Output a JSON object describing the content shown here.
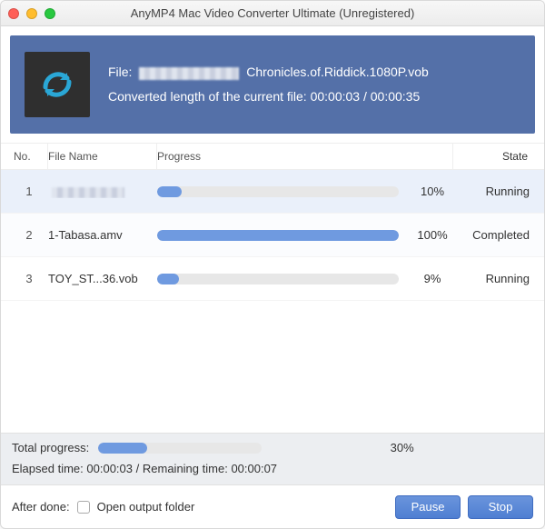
{
  "window": {
    "title": "AnyMP4 Mac Video Converter Ultimate (Unregistered)"
  },
  "banner": {
    "file_label": "File:",
    "file_name_visible": "Chronicles.of.Riddick.1080P.vob",
    "progress_label": "Converted length of the current file:",
    "elapsed": "00:00:03",
    "separator": "/",
    "total": "00:00:35"
  },
  "columns": {
    "no": "No.",
    "file_name": "File Name",
    "progress": "Progress",
    "state": "State"
  },
  "rows": [
    {
      "no": "1",
      "name_obscured": true,
      "name": "",
      "percent": 10,
      "percent_label": "10%",
      "state": "Running"
    },
    {
      "no": "2",
      "name_obscured": false,
      "name": "1-Tabasa.amv",
      "percent": 100,
      "percent_label": "100%",
      "state": "Completed"
    },
    {
      "no": "3",
      "name_obscured": false,
      "name": "TOY_ST...36.vob",
      "percent": 9,
      "percent_label": "9%",
      "state": "Running"
    }
  ],
  "totals": {
    "label": "Total progress:",
    "percent": 30,
    "percent_label": "30%",
    "elapsed_label": "Elapsed time:",
    "elapsed": "00:00:03",
    "remaining_label": "Remaining time:",
    "remaining": "00:00:07",
    "separator": "/"
  },
  "footer": {
    "after_done_label": "After done:",
    "checkbox_checked": false,
    "checkbox_label": "Open output folder",
    "pause": "Pause",
    "stop": "Stop"
  },
  "colors": {
    "accent": "#5470a8",
    "progress_fill": "#6f9ae0"
  }
}
